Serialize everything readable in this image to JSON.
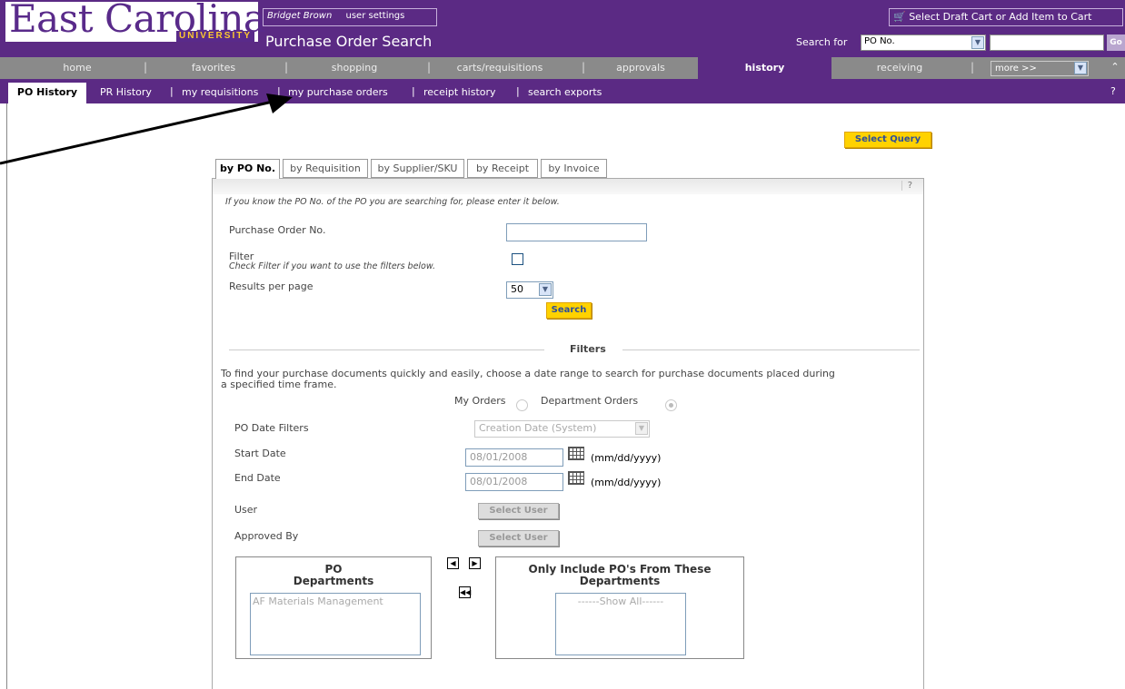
{
  "header": {
    "logo_main": "East Carolina",
    "logo_sub": "UNIVERSITY",
    "user_name": "Bridget Brown",
    "user_settings": "user settings",
    "page_title": "Purchase Order Search",
    "cart_label": "Select Draft Cart or Add Item to Cart",
    "search_for_label": "Search for",
    "search_type": "PO No.",
    "go_label": "Go"
  },
  "nav": {
    "home": "home",
    "favorites": "favorites",
    "shopping": "shopping",
    "carts": "carts/requisitions",
    "approvals": "approvals",
    "history": "history",
    "receiving": "receiving",
    "more": "more >>"
  },
  "subnav": {
    "po_history": "PO History",
    "pr_history": "PR History",
    "my_requisitions": "my requisitions",
    "my_purchase_orders": "my purchase orders",
    "receipt_history": "receipt history",
    "search_exports": "search exports",
    "help": "?"
  },
  "buttons": {
    "select_query": "Select Query",
    "search": "Search",
    "select_user": "Select User",
    "select_user_2": "Select User"
  },
  "tabs": {
    "po": "by PO No.",
    "requisition": "by Requisition",
    "supplier": "by Supplier/SKU",
    "receipt": "by Receipt",
    "invoice": "by Invoice"
  },
  "form": {
    "help": "?",
    "intro": "If you know the PO No. of the PO you are searching for, please enter it below.",
    "po_number_label": "Purchase Order No.",
    "filter_label": "Filter",
    "filter_hint": "Check Filter if you want to use the filters below.",
    "results_label": "Results per page",
    "results_value": "50"
  },
  "filters": {
    "title": "Filters",
    "description_line1": "To find your purchase documents quickly and easily, choose a date range to search for purchase documents placed during",
    "description_line2": "a specified time frame.",
    "my_orders": "My Orders",
    "department_orders": "Department Orders",
    "po_date_filters_label": "PO Date Filters",
    "po_date_filter_value": "Creation Date (System)",
    "start_date_label": "Start Date",
    "start_date_value": "08/01/2008",
    "end_date_label": "End Date",
    "end_date_value": "08/01/2008",
    "date_format": "(mm/dd/yyyy)",
    "date_format_2": "(mm/dd/yyyy)",
    "user_label": "User",
    "approved_by_label": "Approved By"
  },
  "departments": {
    "left_title_1": "PO",
    "left_title_2": "Departments",
    "left_items": [
      "AF Materials Management"
    ],
    "right_title_1": "Only Include PO's From These",
    "right_title_2": "Departments",
    "right_items": [
      "------Show All------"
    ]
  },
  "colors": {
    "brand_purple": "#5b2a84",
    "nav_gray": "#8a8a8a",
    "button_yellow": "#ffd200"
  }
}
